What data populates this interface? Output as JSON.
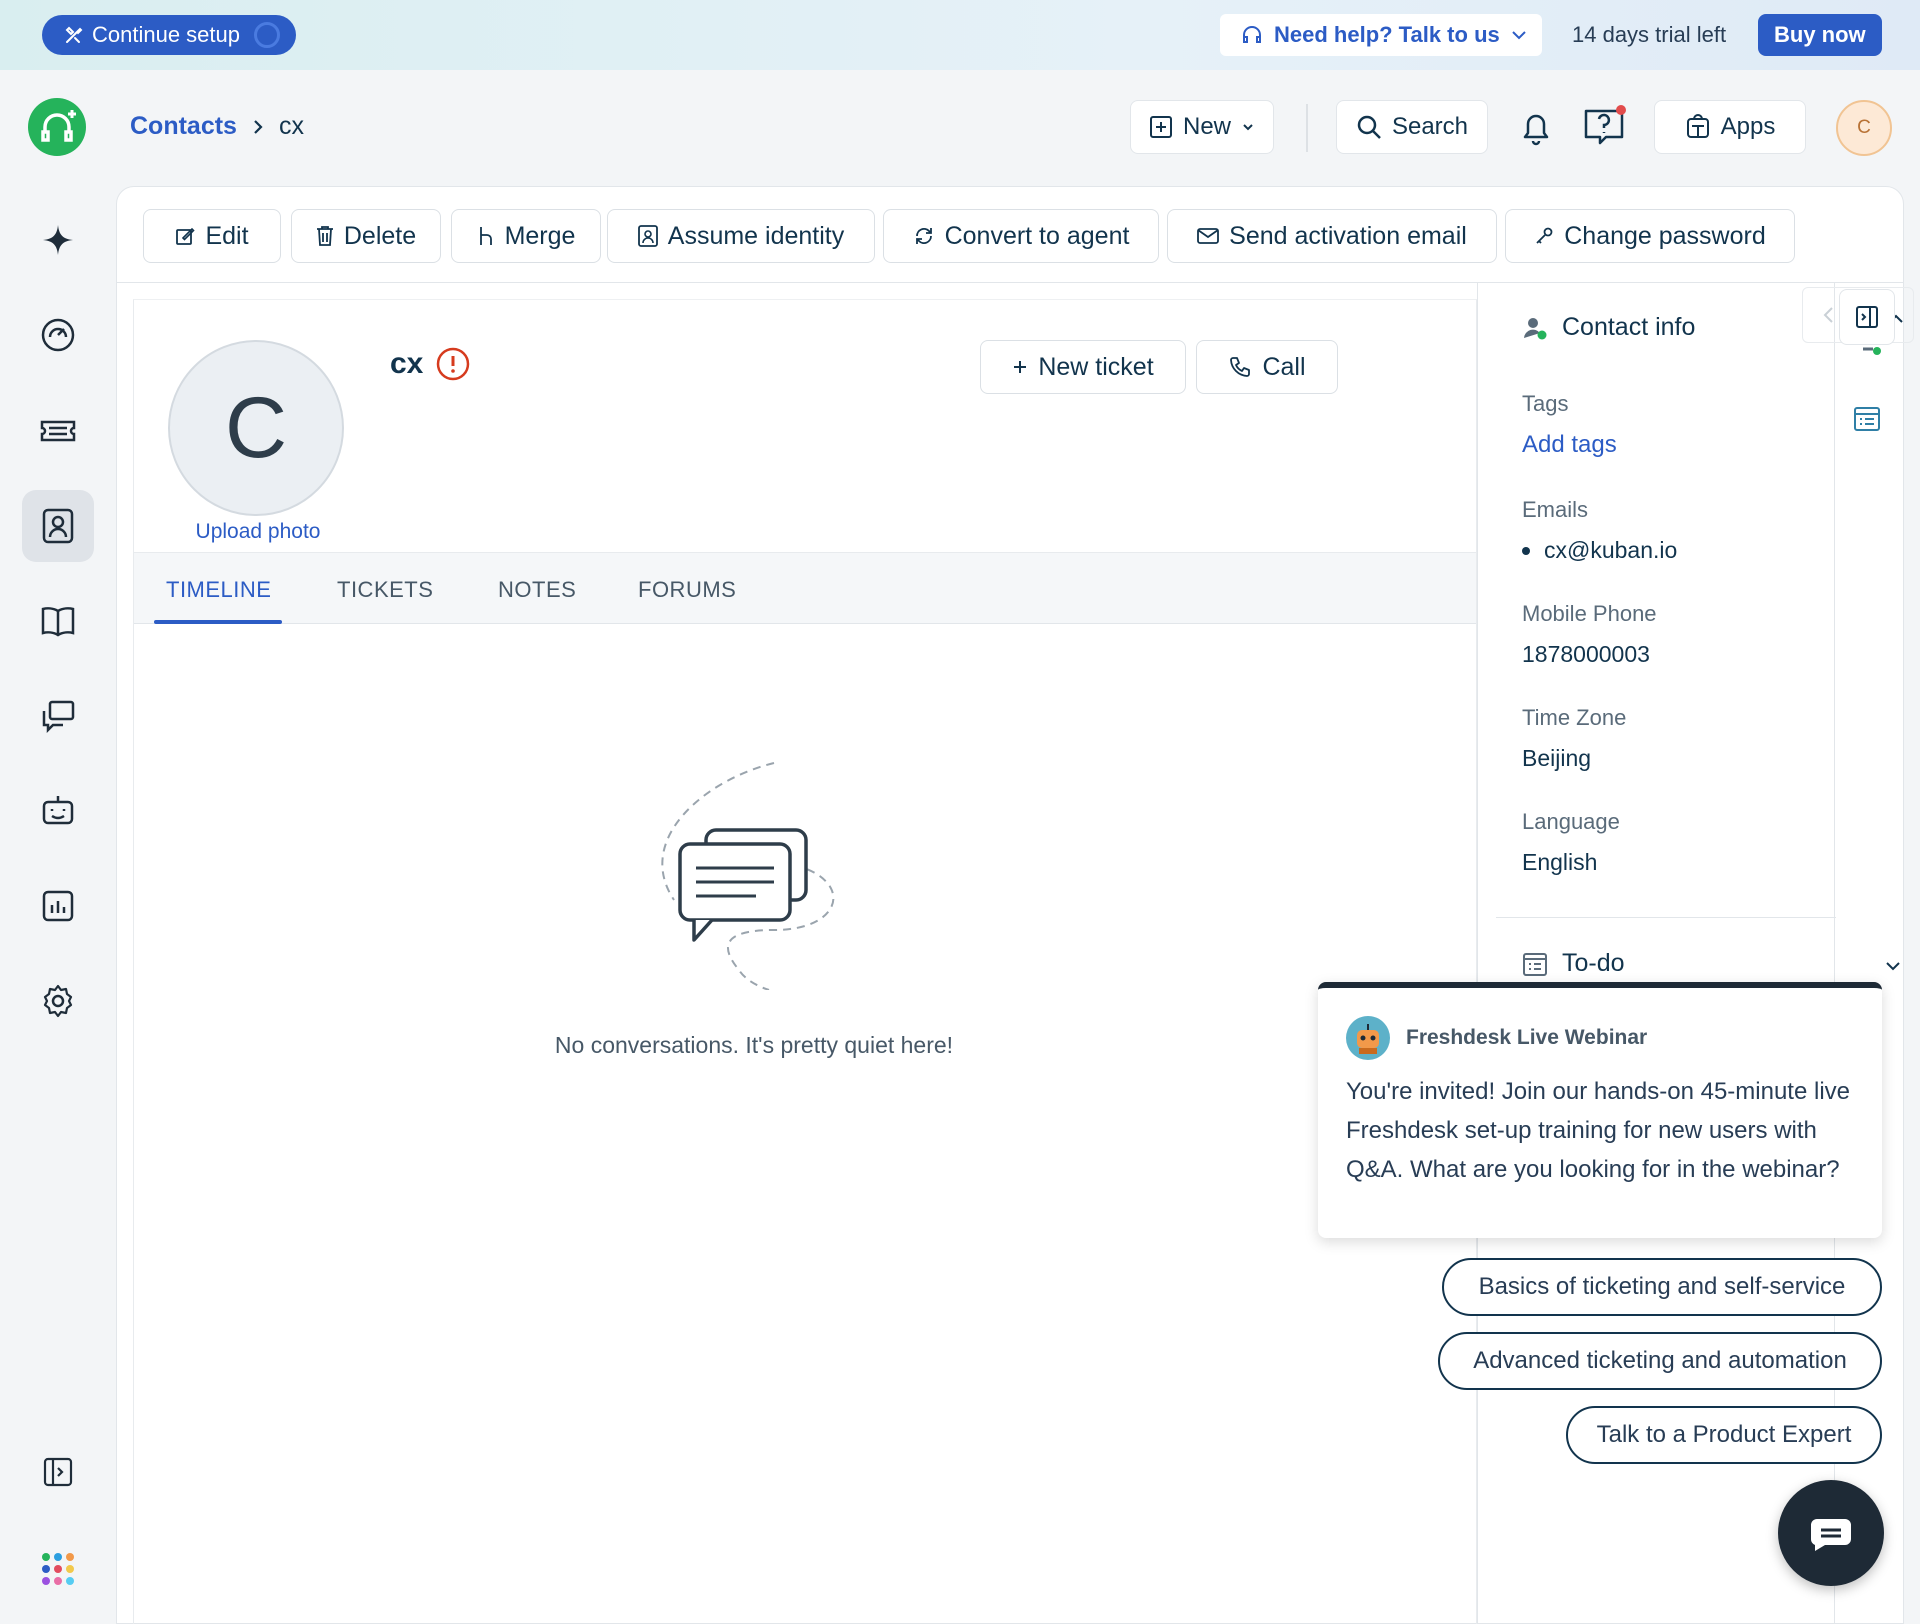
{
  "banner": {
    "continue_setup": "Continue setup",
    "help": "Need help? Talk to us",
    "trial": "14 days trial left",
    "buy_now": "Buy now"
  },
  "header": {
    "breadcrumb_root": "Contacts",
    "breadcrumb_current": "cx",
    "new_label": "New",
    "search_label": "Search",
    "apps_label": "Apps",
    "user_initial": "C"
  },
  "toolbar": {
    "edit": "Edit",
    "delete": "Delete",
    "merge": "Merge",
    "assume_identity": "Assume identity",
    "convert_to_agent": "Convert to agent",
    "send_activation_email": "Send activation email",
    "change_password": "Change password"
  },
  "contact": {
    "initial": "C",
    "name": "cx",
    "upload_photo": "Upload photo",
    "new_ticket": "New ticket",
    "call": "Call"
  },
  "tabs": [
    "TIMELINE",
    "TICKETS",
    "NOTES",
    "FORUMS"
  ],
  "timeline": {
    "empty_message": "No conversations. It's pretty quiet here!"
  },
  "contact_info": {
    "title": "Contact info",
    "tags_label": "Tags",
    "add_tags": "Add tags",
    "emails_label": "Emails",
    "email": "cx@kuban.io",
    "mobile_label": "Mobile Phone",
    "mobile": "1878000003",
    "timezone_label": "Time Zone",
    "timezone": "Beijing",
    "language_label": "Language",
    "language": "English",
    "todo": "To-do"
  },
  "webinar": {
    "title": "Freshdesk Live Webinar",
    "body": "You're invited! Join our hands-on 45-minute live Freshdesk set-up training for new users with Q&A. What are you looking for in the webinar?",
    "options": [
      "Basics of ticketing and self-service",
      "Advanced ticketing and automation",
      "Talk to a Product Expert"
    ]
  },
  "colors": {
    "accent": "#2c5cc5",
    "brand_green": "#25b35b",
    "warning_red": "#d63b1e",
    "dark": "#1e2a36"
  }
}
